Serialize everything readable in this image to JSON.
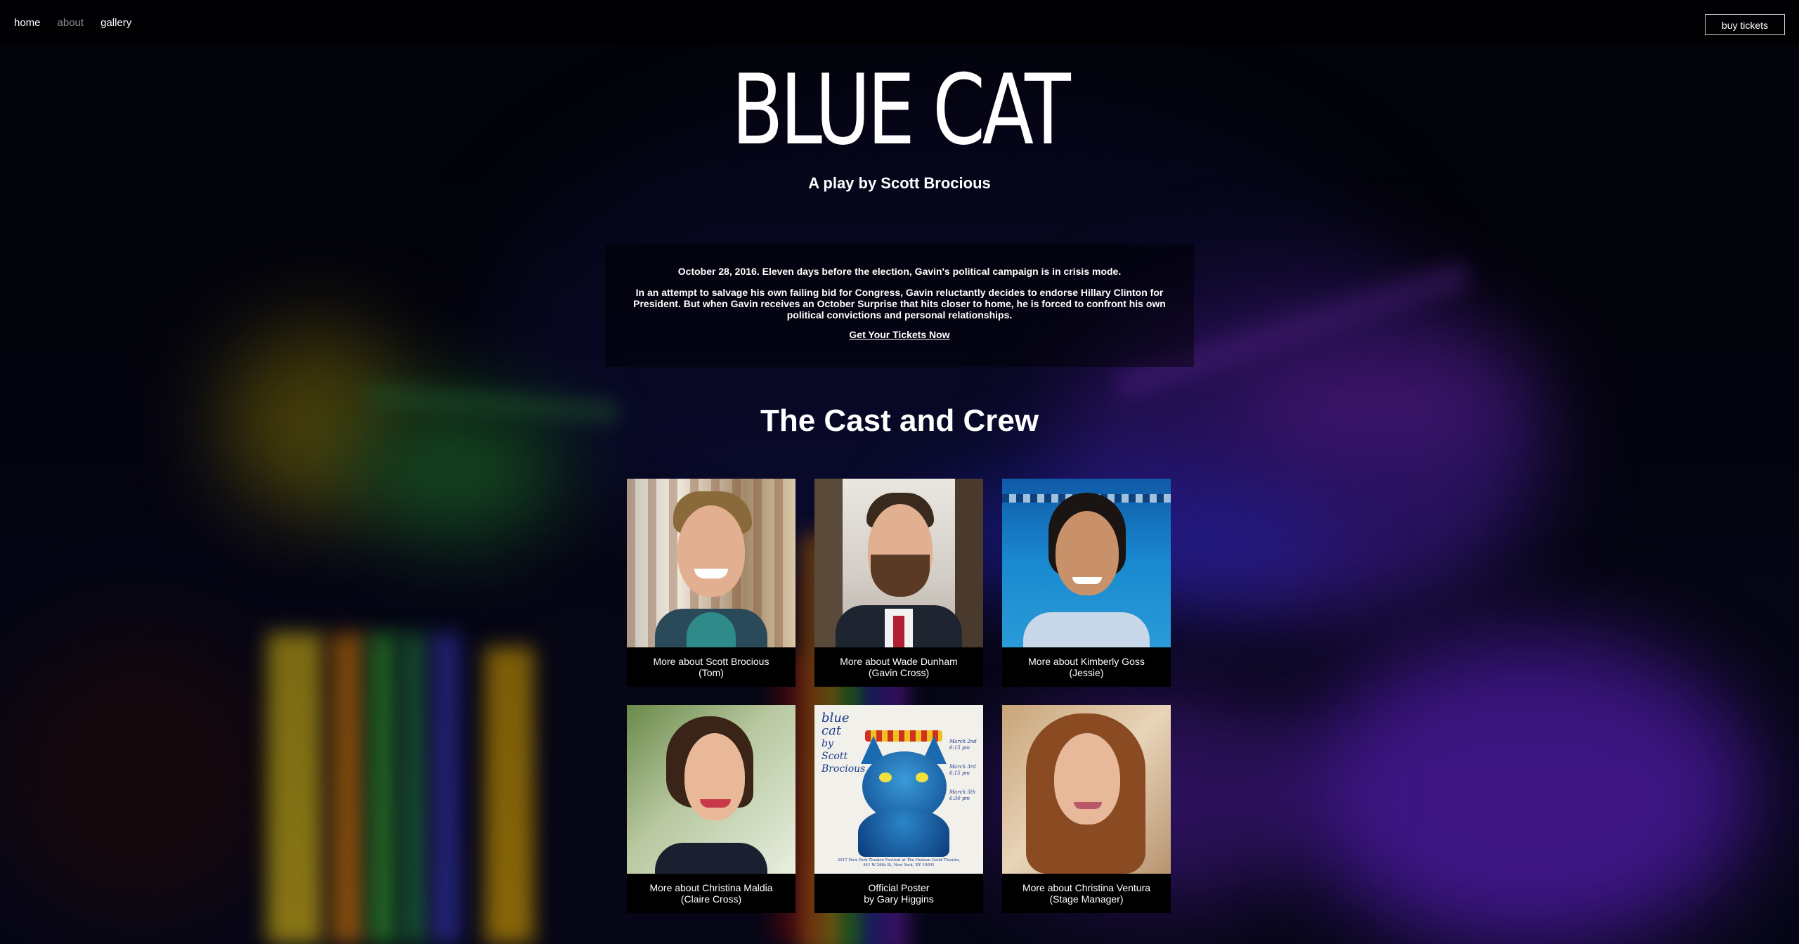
{
  "nav": {
    "items": [
      {
        "label": "home",
        "active": false
      },
      {
        "label": "about",
        "active": true
      },
      {
        "label": "gallery",
        "active": false
      }
    ],
    "buy_label": "buy tickets"
  },
  "hero": {
    "title": "BLUE CAT",
    "subtitle": "A play by Scott Brocious"
  },
  "synopsis": {
    "line1": "October 28, 2016. Eleven days before the election, Gavin's political campaign is in crisis mode.",
    "line2": "In an attempt to salvage his own failing bid for Congress, Gavin reluctantly decides to endorse Hillary Clinton for President. But when Gavin receives an October Surprise that hits closer to home, he is forced to confront his own political convictions and personal relationships.",
    "cta": "Get Your Tickets Now"
  },
  "cast": {
    "heading": "The Cast and Crew",
    "cards": [
      {
        "line1": "More about Scott Brocious",
        "line2": "(Tom)"
      },
      {
        "line1": "More about Wade Dunham",
        "line2": "(Gavin Cross)"
      },
      {
        "line1": "More about Kimberly Goss",
        "line2": "(Jessie)"
      },
      {
        "line1": "More about Christina Maldia",
        "line2": "(Claire Cross)"
      },
      {
        "line1": "Official Poster",
        "line2": "by Gary Higgins"
      },
      {
        "line1": "More about Christina Ventura",
        "line2": "(Stage Manager)"
      }
    ],
    "poster": {
      "title_lines": [
        "blue",
        "cat",
        "by",
        "Scott",
        "Brocious"
      ],
      "dates": [
        "March 2nd 6:15 pm",
        "March 3rd 6:15 pm",
        "March 5th 6:30 pm"
      ],
      "footer": "2017 New York Theatre Festival at The Hudson Guild Theatre, 441 W 26th St, New York, NY 10001"
    }
  }
}
